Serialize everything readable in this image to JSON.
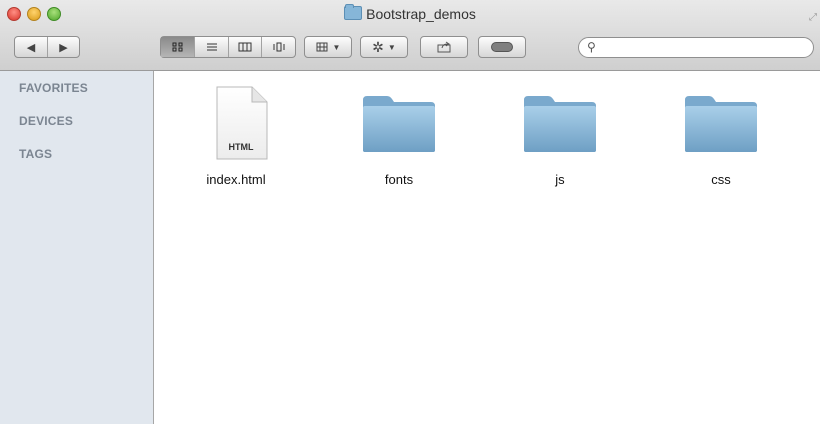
{
  "window": {
    "title": "Bootstrap_demos"
  },
  "toolbar": {
    "nav": [
      "◀",
      "▶"
    ],
    "view_modes": [
      "icon-view",
      "list-view",
      "column-view",
      "coverflow-view"
    ],
    "arrange_icon": "grid-arrange-icon",
    "action_icon": "gear-icon",
    "share_icon": "share-icon",
    "tags_icon": "tag-toggle-icon",
    "search_placeholder": ""
  },
  "sidebar": {
    "sections": [
      {
        "label": "FAVORITES"
      },
      {
        "label": "DEVICES"
      },
      {
        "label": "TAGS"
      }
    ]
  },
  "files": [
    {
      "name": "index.html",
      "kind": "html-document",
      "badge": "HTML"
    },
    {
      "name": "fonts",
      "kind": "folder"
    },
    {
      "name": "js",
      "kind": "folder"
    },
    {
      "name": "css",
      "kind": "folder"
    }
  ],
  "colors": {
    "folder": "#8ab8d9",
    "sidebar_bg": "#e1e7ee",
    "sidebar_text": "#7b8591"
  }
}
